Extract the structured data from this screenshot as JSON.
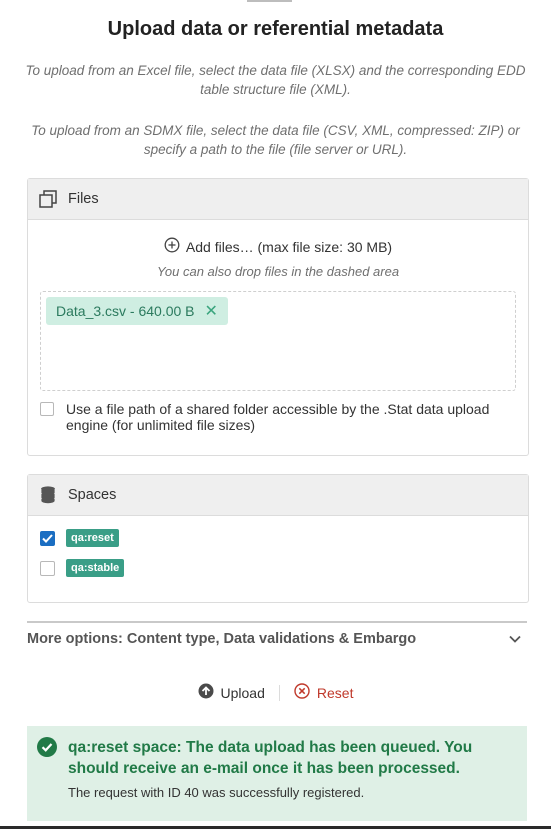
{
  "page": {
    "title": "Upload data or referential metadata",
    "intro_excel": "To upload from an Excel file, select the data file (XLSX) and the corresponding EDD table structure file (XML).",
    "intro_sdmx": "To upload from an SDMX file, select the data file (CSV, XML, compressed: ZIP) or specify a path to the file (file server or URL)."
  },
  "files_panel": {
    "header": "Files",
    "add_files_label": "Add files… (max file size: 30 MB)",
    "drop_hint": "You can also drop files in the dashed area",
    "chip_label": "Data_3.csv - 640.00 B",
    "shared_path_label": "Use a file path of a shared folder accessible by the .Stat data upload engine (for unlimited file sizes)",
    "shared_path_checked": false
  },
  "spaces_panel": {
    "header": "Spaces",
    "items": [
      {
        "label": "qa:reset",
        "checked": true
      },
      {
        "label": "qa:stable",
        "checked": false
      }
    ]
  },
  "more_options": {
    "label": "More options: Content type, Data validations & Embargo"
  },
  "actions": {
    "upload_label": "Upload",
    "reset_label": "Reset"
  },
  "alert": {
    "message": "qa:reset space: The data upload has been queued. You should receive an e-mail once it has been processed.",
    "detail": "The request with ID 40 was successfully registered."
  },
  "colors": {
    "accent": "#1b6ec2",
    "success": "#217a47",
    "tag": "#3a9e87",
    "reset": "#c0392b"
  },
  "icons": [
    "copy-icon",
    "add-circle-icon",
    "close-icon",
    "database-icon",
    "check-icon",
    "chevron-down-icon",
    "upload-icon",
    "reset-icon",
    "success-icon"
  ]
}
